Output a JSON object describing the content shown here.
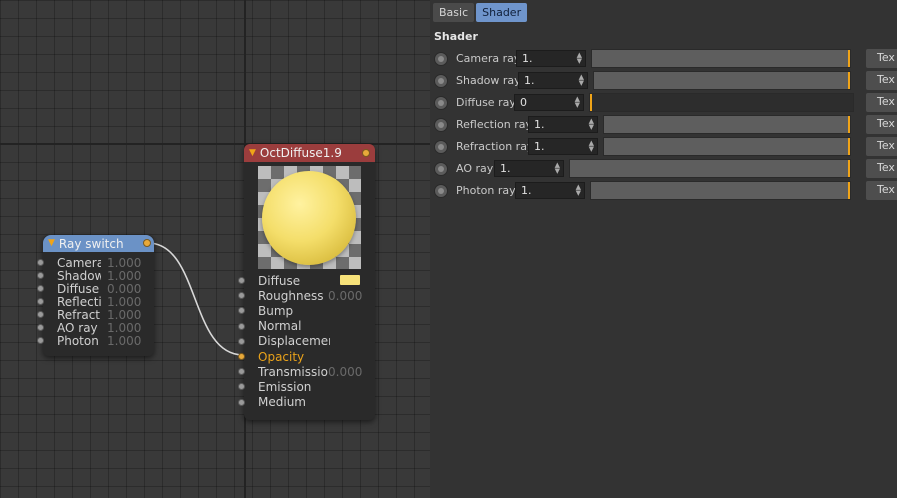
{
  "node_editor": {
    "ray_switch_node": {
      "title": "Ray switch",
      "ports": [
        {
          "label": "Camera",
          "value": "1.000"
        },
        {
          "label": "Shadow",
          "value": "1.000"
        },
        {
          "label": "Diffuse r",
          "value": "0.000"
        },
        {
          "label": "Reflectio",
          "value": "1.000"
        },
        {
          "label": "Refractio",
          "value": "1.000"
        },
        {
          "label": "AO ray",
          "value": "1.000"
        },
        {
          "label": "Photon r",
          "value": "1.000"
        }
      ]
    },
    "material_node": {
      "title": "OctDiffuse1.9",
      "ports": [
        {
          "label": "Diffuse",
          "value": ""
        },
        {
          "label": "Roughness",
          "value": "0.000"
        },
        {
          "label": "Bump",
          "value": ""
        },
        {
          "label": "Normal",
          "value": ""
        },
        {
          "label": "Displacement",
          "value": ""
        },
        {
          "label": "Opacity",
          "value": ""
        },
        {
          "label": "Transmissio",
          "value": "0.000"
        },
        {
          "label": "Emission",
          "value": ""
        },
        {
          "label": "Medium",
          "value": ""
        }
      ],
      "diffuse_color": "#f7e27a",
      "connected_port": "Opacity"
    }
  },
  "attributes": {
    "tabs": [
      {
        "label": "Basic",
        "active": false
      },
      {
        "label": "Shader",
        "active": true
      }
    ],
    "section_title": "Shader",
    "params": [
      {
        "label": "Camera ray",
        "value": "1.",
        "level": 1.0,
        "button": "Tex"
      },
      {
        "label": "Shadow ray",
        "value": "1.",
        "level": 1.0,
        "button": "Tex"
      },
      {
        "label": "Diffuse ray",
        "value": "0",
        "level": 0.0,
        "button": "Tex"
      },
      {
        "label": "Reflection ray",
        "value": "1.",
        "level": 1.0,
        "button": "Tex"
      },
      {
        "label": "Refraction ray",
        "value": "1.",
        "level": 1.0,
        "button": "Tex"
      },
      {
        "label": "AO ray",
        "value": "1.",
        "level": 1.0,
        "button": "Tex"
      },
      {
        "label": "Photon ray",
        "value": "1.",
        "level": 1.0,
        "button": "Tex"
      }
    ]
  },
  "colors": {
    "accent": "#f0a418",
    "ray_switch_header": "#6b92c6",
    "material_header": "#9b3d3d",
    "active_tab": "#6f95cc"
  }
}
